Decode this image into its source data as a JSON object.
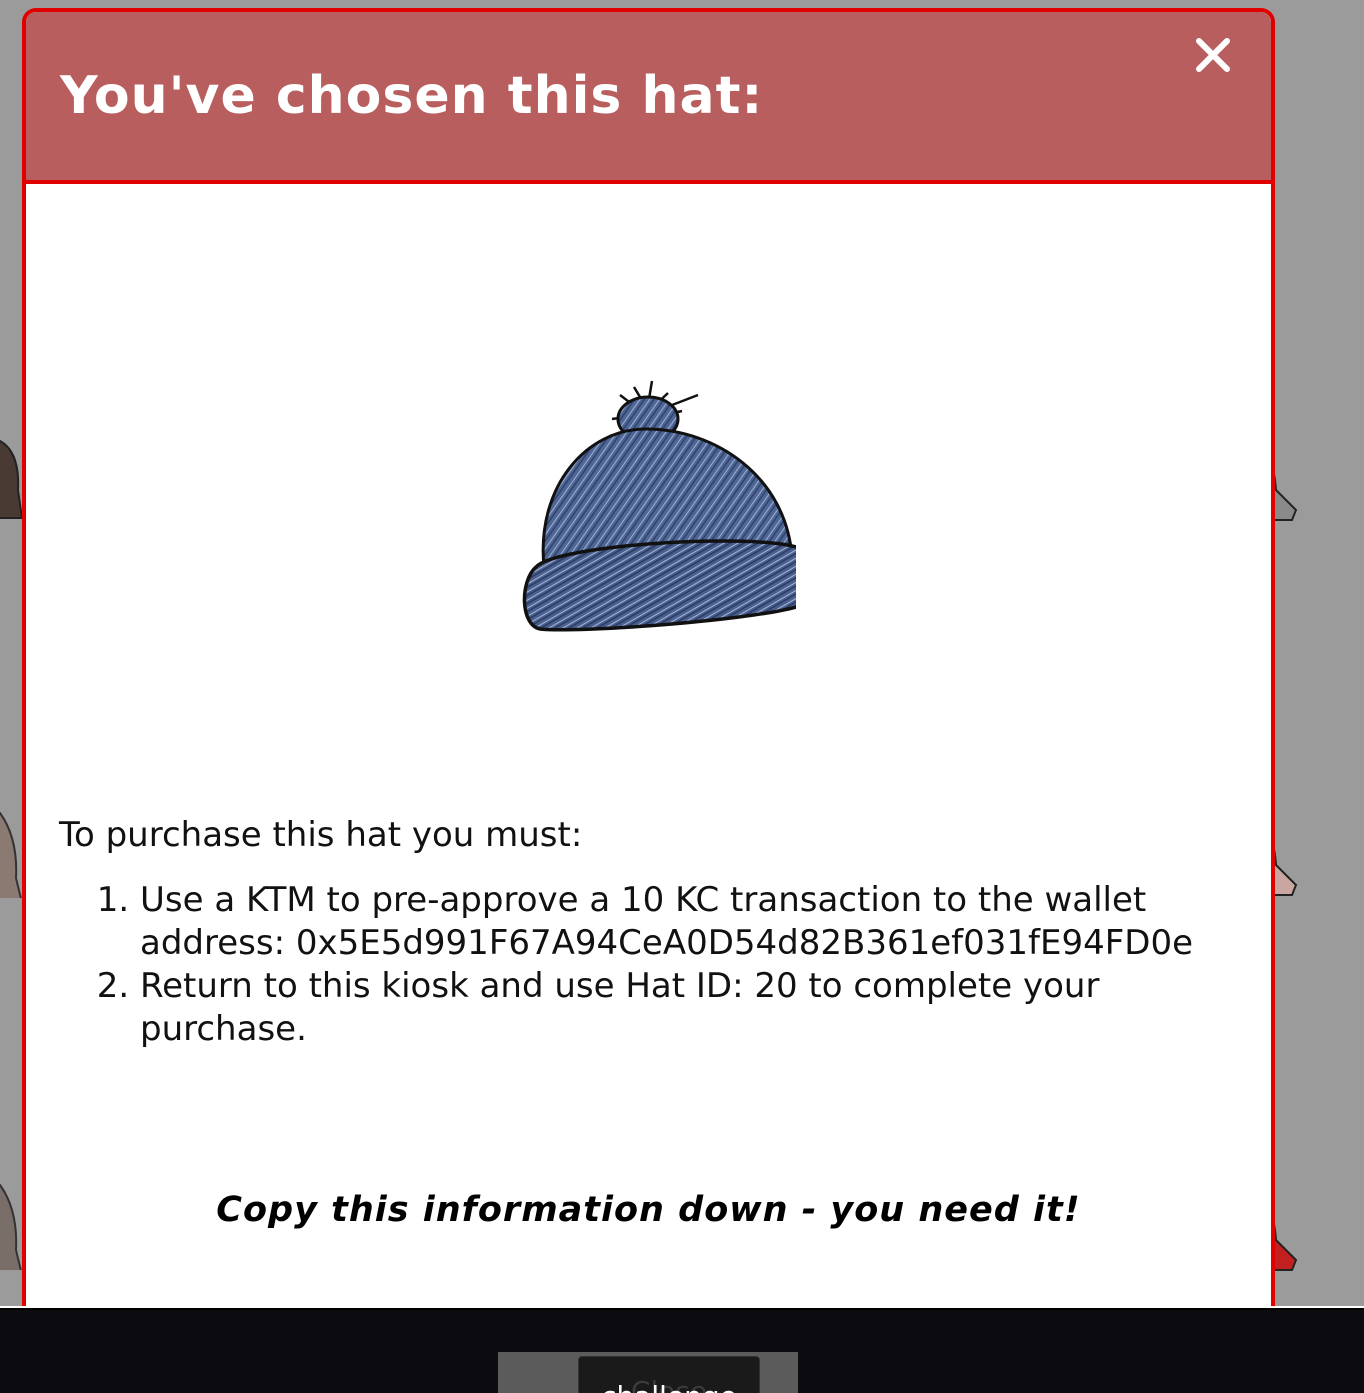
{
  "modal": {
    "title": "You've chosen this hat:",
    "close_icon": "close-icon",
    "hat_image_icon": "knit-beanie-hat",
    "instructions": {
      "intro": "To purchase this hat you must:",
      "steps": [
        "Use a KTM to pre-approve a 10 KC transaction to the wallet address: 0x5E5d991F67A94CeA0D54d82B361ef031fE94FD0e",
        "Return to this kiosk and use Hat ID: 20 to complete your purchase."
      ]
    },
    "warning": "Copy this information down - you need it!"
  },
  "footer": {
    "close_label": "Close",
    "overlap_label": "challenge"
  },
  "colors": {
    "header_bg": "#b95e5e",
    "border": "#e00000",
    "backdrop": "#9b9b9b",
    "footer_bg": "#0c0c10"
  }
}
